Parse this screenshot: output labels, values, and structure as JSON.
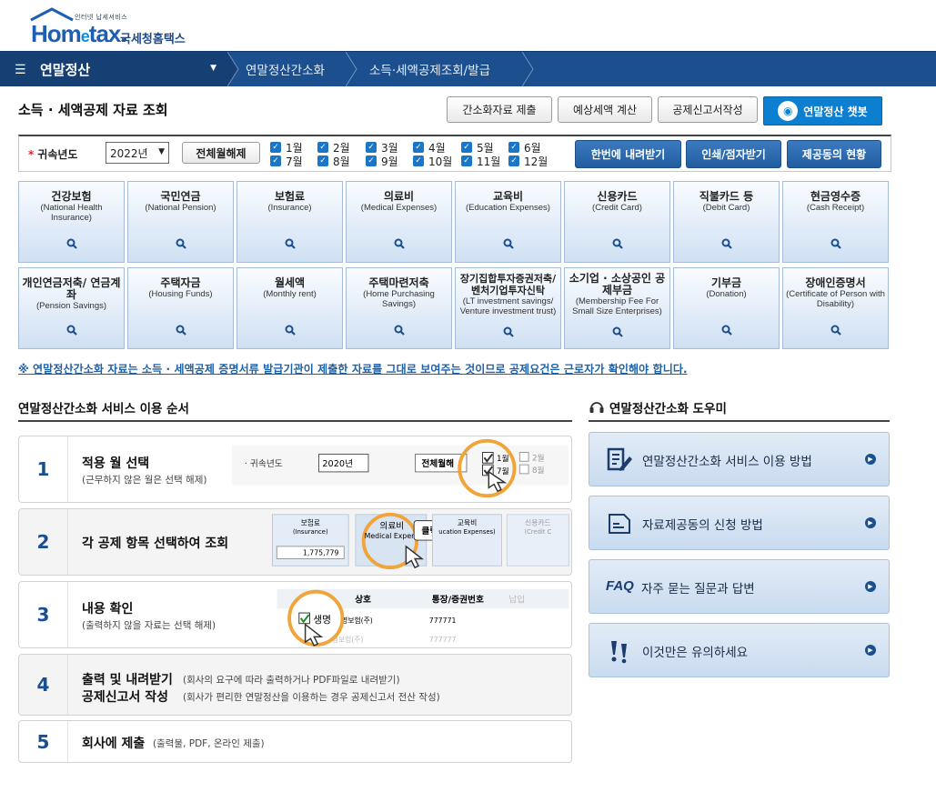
{
  "header": {
    "logo_sub": "인터넷 납세서비스",
    "logo_brand_a": "Hom",
    "logo_brand_e": "e",
    "logo_brand_b": "tax.",
    "logo_kname": "국세청홈택스"
  },
  "nav": {
    "main": "연말정산",
    "crumb1": "연말정산간소화",
    "crumb2": "소득·세액공제조회/발급"
  },
  "page": {
    "title": "소득 · 세액공제 자료 조회",
    "buttons": {
      "submit": "간소화자료 제출",
      "estimate": "예상세액 계산",
      "deduction": "공제신고서작성",
      "chatbot": "연말정산 챗봇"
    }
  },
  "filter": {
    "label": "귀속년도",
    "required_mark": "*",
    "year": "2022년",
    "clear_all": "전체월해제",
    "months": [
      "1월",
      "2월",
      "3월",
      "4월",
      "5월",
      "6월",
      "7월",
      "8월",
      "9월",
      "10월",
      "11월",
      "12월"
    ],
    "download_all": "한번에 내려받기",
    "print": "인쇄/점자받기",
    "consent": "제공동의 현황"
  },
  "categories": [
    {
      "ko": "건강보험",
      "en": "(National Health Insurance)"
    },
    {
      "ko": "국민연금",
      "en": "(National Pension)"
    },
    {
      "ko": "보험료",
      "en": "(Insurance)"
    },
    {
      "ko": "의료비",
      "en": "(Medical Expenses)"
    },
    {
      "ko": "교육비",
      "en": "(Education Expenses)"
    },
    {
      "ko": "신용카드",
      "en": "(Credit Card)"
    },
    {
      "ko": "직불카드 등",
      "en": "(Debit Card)"
    },
    {
      "ko": "현금영수증",
      "en": "(Cash Receipt)"
    },
    {
      "ko": "개인연금저축/ 연금계좌",
      "en": "(Pension Savings)"
    },
    {
      "ko": "주택자금",
      "en": "(Housing Funds)"
    },
    {
      "ko": "월세액",
      "en": "(Monthly rent)"
    },
    {
      "ko": "주택마련저축",
      "en": "(Home Purchasing Savings)"
    },
    {
      "ko": "장기집합투자증권저축/ 벤처기업투자신탁",
      "en": "(LT investment savings/ Venture investment trust)"
    },
    {
      "ko": "소기업 · 소상공인 공제부금",
      "en": "(Membership Fee For Small Size Enterprises)"
    },
    {
      "ko": "기부금",
      "en": "(Donation)"
    },
    {
      "ko": "장애인증명서",
      "en": "(Certificate of Person with Disability)"
    }
  ],
  "notice": "※ 연말정산간소화 자료는 소득 · 세액공제 증명서류 발급기관이 제출한 자료를 그대로 보여주는 것이므로 공제요건은 근로자가 확인해야 합니다.",
  "steps_title": "연말정산간소화 서비스 이용 순서",
  "steps": [
    {
      "num": "1",
      "title": "적용 월 선택",
      "desc": "(근무하지 않은 월은 선택 해제)"
    },
    {
      "num": "2",
      "title": "각 공제 항목 선택하여 조회",
      "desc": ""
    },
    {
      "num": "3",
      "title": "내용 확인",
      "desc": "(출력하지 않을 자료는 선택 해제)"
    },
    {
      "num": "4",
      "title": "출력 및 내려받기",
      "desc": "(회사의 요구에 따라 출력하거나 PDF파일로 내려받기)",
      "title2": "공제신고서 작성",
      "desc2": "(회사가 편리한 연말정산을 이용하는 경우 공제신고서 전산 작성)"
    },
    {
      "num": "5",
      "title": "회사에 제출",
      "desc": "(출력물, PDF, 온라인 제출)"
    }
  ],
  "illus": {
    "s1_label": "귀속년도",
    "s1_year": "2020년",
    "s1_btn": "전체월해",
    "s1_m1": "1월",
    "s1_m7": "7월",
    "s1_m2": "2월",
    "s1_m8": "8월",
    "s2_c1": "보험료",
    "s2_c1en": "(Insurance)",
    "s2_val": "1,775,779",
    "s2_c2": "의료비",
    "s2_c2en": "Medical Expen",
    "s2_click": "클릭!",
    "s2_c3": "교육비",
    "s2_c3en": "ucation Expenses)",
    "s2_c4": "신용카드",
    "s2_c4en": "(Credit C",
    "s3_h1": "상호",
    "s3_h2": "통장/증권번호",
    "s3_h3": "납입",
    "s3_r1a": "생명",
    "s3_r1b": "보생명보험(주)",
    "s3_r1c": "777771",
    "s3_r2b": "교보생명보험(주)",
    "s3_r2c": "777777"
  },
  "helper_title": "연말정산간소화 도우미",
  "helper": [
    {
      "icon": "pencil-doc-icon",
      "label": "연말정산간소화 서비스 이용 방법"
    },
    {
      "icon": "document-icon",
      "label": "자료제공동의 신청 방법"
    },
    {
      "icon": "faq-icon",
      "label": "자주 묻는 질문과 답변",
      "faq": "FAQ"
    },
    {
      "icon": "exclamation-icon",
      "label": "이것만은 유의하세요"
    }
  ]
}
